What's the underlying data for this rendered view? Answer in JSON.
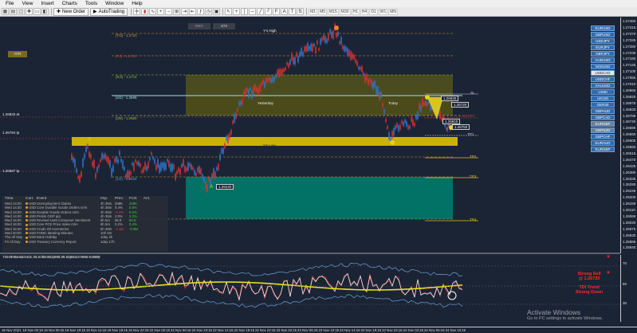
{
  "menu": [
    "File",
    "View",
    "Insert",
    "Charts",
    "Tools",
    "Window",
    "Help"
  ],
  "toolbar": {
    "new_order": "New Order",
    "autotrading": "AutoTrading",
    "timeframes": [
      "M1",
      "M5",
      "M15",
      "M30",
      "H1",
      "H4",
      "D1",
      "W1",
      "MN"
    ]
  },
  "chart": {
    "tab_labels": [
      "ENG",
      "Z73"
    ],
    "badge": "ATR",
    "y_high": "Y's High",
    "y_low": "Y's Low",
    "yesterday": "Yesterday",
    "today": "Today",
    "pivot_labels": [
      "[T/2] - 1.2741",
      "[R3] - 1.2726",
      "[S/2] - 1.2711",
      "[4/2] - 1.2695",
      "[3/8] - 1.2680",
      "[1/2] - 1.2634"
    ],
    "tp_labels": [
      "SL",
      "ENTRY",
      "TP1",
      "TP2",
      "TP3",
      "TP4"
    ],
    "entry_value": "1.26830",
    "box_values": [
      "1.26720",
      "1.26810",
      "1.26750"
    ],
    "left_markers": [
      "1.26833 at",
      "1.26784 tp",
      "1.26687 tp"
    ],
    "low_marker": "1.26240"
  },
  "price_axis": [
    "1.27460",
    "1.27415",
    "1.27370",
    "1.27325",
    "1.27280",
    "1.27235",
    "1.27190",
    "1.27145",
    "1.27100",
    "1.27055",
    "1.27010",
    "1.26965",
    "1.26920",
    "1.26875",
    "1.26830",
    "1.26785",
    "1.26740",
    "1.26695",
    "1.26650",
    "1.26605",
    "1.26560",
    "1.26515",
    "1.26470",
    "1.26425",
    "1.26380",
    "1.26335",
    "1.26290",
    "1.26245",
    "1.26200",
    "1.26155",
    "1.26110",
    "1.26065",
    "1.26020",
    "1.25975",
    "1.25930",
    "1.25885",
    "1.25840"
  ],
  "symbols": [
    {
      "name": "EURUSD",
      "state": "normal"
    },
    {
      "name": "GBPUSD",
      "state": "normal"
    },
    {
      "name": "USDJPY",
      "state": "normal"
    },
    {
      "name": "EURJPY",
      "state": "normal"
    },
    {
      "name": "GBPJPY",
      "state": "normal"
    },
    {
      "name": "AUDUSD",
      "state": "normal"
    },
    {
      "name": "NZDUSD",
      "state": "normal"
    },
    {
      "name": "USDCAD",
      "state": "active"
    },
    {
      "name": "USDCHF",
      "state": "normal"
    },
    {
      "name": "XAUUSD",
      "state": "normal"
    },
    {
      "name": "US30",
      "state": "normal"
    },
    {
      "name": "UK100",
      "state": "normal"
    },
    {
      "name": "GER30",
      "state": "normal"
    },
    {
      "name": "GBPAUD",
      "state": "normal"
    },
    {
      "name": "GBPCAD",
      "state": "normal"
    },
    {
      "name": "EURGBP",
      "state": "sel"
    },
    {
      "name": "GBPNZD",
      "state": "sel"
    },
    {
      "name": "GBPCHF",
      "state": "normal"
    },
    {
      "name": "EURAUD",
      "state": "normal"
    },
    {
      "name": "EURGBP",
      "state": "normal"
    }
  ],
  "news": {
    "headers": [
      "Time",
      "Curr.",
      "Event",
      "Imp.",
      "Prev.",
      "Fcst.",
      "Act."
    ],
    "rows": [
      {
        "time": "Wed 14:30",
        "cur": "USD",
        "event": "Unemployment Claims",
        "imp": "4h 35m",
        "prev": "268K",
        "fcst": "260K",
        "act": ""
      },
      {
        "time": "Wed 14:30",
        "cur": "USD",
        "event": "Core Durable Goods Orders m/m",
        "imp": "4h 35m",
        "prev": "0.4%",
        "fcst": "0.5%",
        "act": ""
      },
      {
        "time": "Wed 14:30",
        "cur": "USD",
        "event": "Durable Goods Orders m/m",
        "imp": "4h 35m",
        "prev": "-0.4%",
        "fcst": "0.2%",
        "act": ""
      },
      {
        "time": "Wed 14:30",
        "cur": "USD",
        "event": "Prelim GDP q/q",
        "imp": "4h 35m",
        "prev": "2.0%",
        "fcst": "2.2%",
        "act": ""
      },
      {
        "time": "Wed 16:00",
        "cur": "USD",
        "event": "Revised UoM Consumer Sentiment",
        "imp": "6h 5m",
        "prev": "66.8",
        "fcst": "66.8",
        "act": ""
      },
      {
        "time": "Wed 16:00",
        "cur": "USD",
        "event": "Core PCE Price Index m/m",
        "imp": "6h 5m",
        "prev": "0.2%",
        "fcst": "0.4%",
        "act": ""
      },
      {
        "time": "Wed 16:30",
        "cur": "USD",
        "event": "Crude Oil Inventories",
        "imp": "6h 35m",
        "prev": "-2.1M",
        "fcst": "-0.9M",
        "act": ""
      },
      {
        "time": "Wed 20:00",
        "cur": "USD",
        "event": "FOMC Meeting Minutes",
        "imp": "10h 5m",
        "prev": "",
        "fcst": "",
        "act": ""
      },
      {
        "time": "Thu All Day",
        "cur": "USD",
        "event": "Bank Holiday",
        "imp": "1day 2h",
        "prev": "",
        "fcst": "",
        "act": ""
      },
      {
        "time": "Fri All Day",
        "cur": "USD",
        "event": "Treasury Currency Report",
        "imp": "1day 17h",
        "prev": "",
        "fcst": "",
        "act": ""
      }
    ],
    "footer": "GMT-Stamp/2 v 1.7.2     ... forexsignals.co     Signals: Forex Factory"
  },
  "indicator": {
    "title": "TDI Alerts  62.9431 45.6090 36.2688 35.8289 42.4960 0.0000",
    "levels": [
      "70",
      "50",
      "30"
    ]
  },
  "signals": {
    "line1": "Strong Sell",
    "line2": "@ 1.26720",
    "line3": "TDI Trend",
    "line4": "Strong Down"
  },
  "time_axis": [
    "18 Nov 2021",
    "19 Nov 02:15",
    "19 Nov 06:15",
    "19 Nov 10:15",
    "19 Nov 14:15",
    "19 Nov 18:15",
    "19 Nov 22:15",
    "22 Nov 02:15",
    "22 Nov 06:15",
    "22 Nov 10:15",
    "22 Nov 14:15",
    "22 Nov 18:15",
    "22 Nov 22:15",
    "23 Nov 02:15",
    "23 Nov 06:15",
    "23 Nov 10:15",
    "23 Nov 14:15",
    "23 Nov 18:15",
    "23 Nov 22:15",
    "24 Nov 02:15",
    "24 Nov 06:15",
    "24 Nov 10:15"
  ],
  "watermark": {
    "title": "Activate Windows",
    "sub": "Go to PC settings to activate Windows."
  },
  "colors": {
    "bg": "#1b2434",
    "yellow_zone": "#c8b400",
    "teal_zone": "#007a6c",
    "signal_red": "#ff2a2a",
    "candle_blue": "#2f73c8",
    "candle_red": "#d43030"
  }
}
